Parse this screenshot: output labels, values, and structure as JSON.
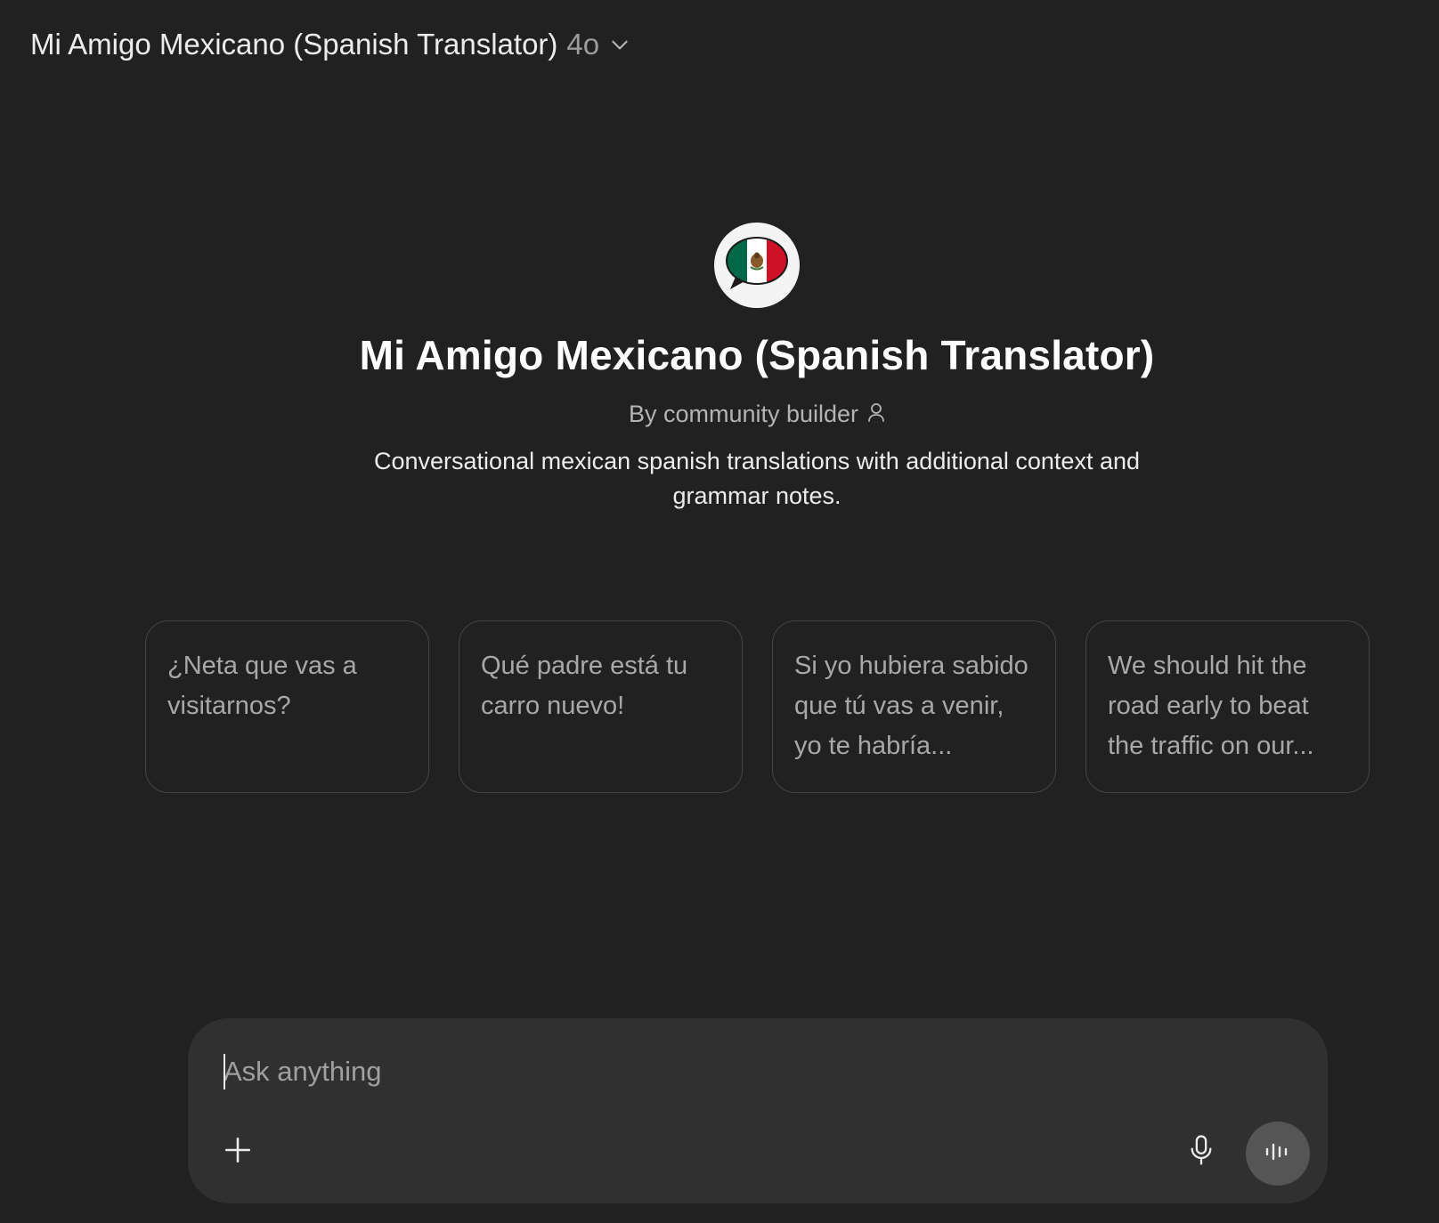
{
  "header": {
    "title": "Mi Amigo Mexicano (Spanish Translator)",
    "model": "4o",
    "chevron_icon": "chevron-down-icon"
  },
  "gpt": {
    "avatar_icon": "mexico-flag-speech-bubble-icon",
    "title": "Mi Amigo Mexicano (Spanish Translator)",
    "byline": "By community builder",
    "byline_icon": "person-icon",
    "description": "Conversational mexican spanish translations with additional context and grammar notes."
  },
  "suggestions": [
    {
      "text": "¿Neta que vas a visitarnos?"
    },
    {
      "text": "Qué padre está tu carro nuevo!"
    },
    {
      "text": "Si yo hubiera sabido que tú vas a venir, yo te habría..."
    },
    {
      "text": "We should hit the road early to beat the traffic on our..."
    }
  ],
  "composer": {
    "placeholder": "Ask anything",
    "value": "",
    "plus_icon": "plus-icon",
    "mic_icon": "microphone-icon",
    "voice_icon": "voice-mode-icon"
  },
  "colors": {
    "background": "#212121",
    "composer": "#303030",
    "card_border": "#444444",
    "voice_button": "#555555",
    "flag_green": "#006847",
    "flag_red": "#ce1126"
  }
}
